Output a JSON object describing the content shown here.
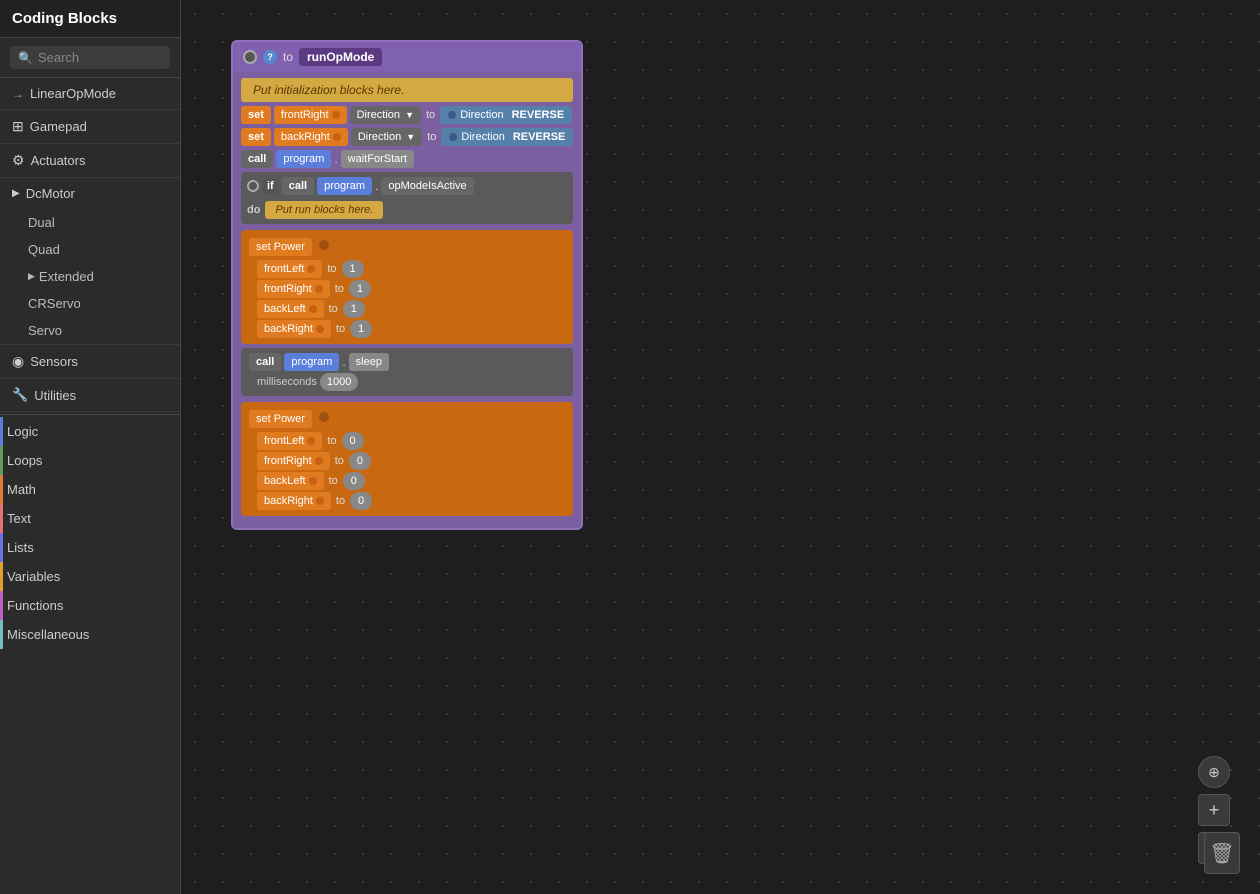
{
  "sidebar": {
    "title": "Coding Blocks",
    "search_placeholder": "Search",
    "items": [
      {
        "id": "linear-op-mode",
        "label": "LinearOpMode",
        "icon": "→",
        "type": "arrow"
      },
      {
        "id": "gamepad",
        "label": "Gamepad",
        "icon": "⊞",
        "type": "icon"
      },
      {
        "id": "actuators",
        "label": "Actuators",
        "icon": "⚙",
        "type": "icon"
      },
      {
        "id": "dc-motor",
        "label": "DcMotor",
        "icon": "▶",
        "type": "expand"
      },
      {
        "id": "dual",
        "label": "Dual",
        "type": "sub"
      },
      {
        "id": "quad",
        "label": "Quad",
        "type": "sub"
      },
      {
        "id": "extended",
        "label": "Extended",
        "type": "sub-expand"
      },
      {
        "id": "crservo",
        "label": "CRServo",
        "type": "sub"
      },
      {
        "id": "servo",
        "label": "Servo",
        "type": "sub"
      },
      {
        "id": "sensors",
        "label": "Sensors",
        "icon": "👁",
        "type": "icon"
      },
      {
        "id": "utilities",
        "label": "Utilities",
        "icon": "🔧",
        "type": "icon"
      }
    ],
    "categories": [
      {
        "id": "logic",
        "label": "Logic",
        "color": "#5b7edb"
      },
      {
        "id": "loops",
        "label": "Loops",
        "color": "#5b9e5b"
      },
      {
        "id": "math",
        "label": "Math",
        "color": "#e07b3a"
      },
      {
        "id": "text",
        "label": "Text",
        "color": "#e87070"
      },
      {
        "id": "lists",
        "label": "Lists",
        "color": "#7070e8"
      },
      {
        "id": "variables",
        "label": "Variables",
        "color": "#e0a030"
      },
      {
        "id": "functions",
        "label": "Functions",
        "color": "#c060c0"
      },
      {
        "id": "miscellaneous",
        "label": "Miscellaneous",
        "color": "#70c0c0"
      }
    ]
  },
  "canvas": {
    "blocks": {
      "op_mode_header": {
        "to_label": "to",
        "run_label": "runOpMode"
      },
      "init_placeholder": "Put initialization blocks here.",
      "set1_label": "set",
      "front_right_label": "frontRight",
      "direction_label1": "Direction",
      "to_label": "to",
      "direction_block1": "Direction",
      "reverse_label1": "REVERSE",
      "set2_label": "set",
      "back_right_label": "backRight",
      "direction_label2": "Direction",
      "direction_block2": "Direction",
      "reverse_label2": "REVERSE",
      "call_label1": "call",
      "program_label1": "program",
      "wait_for_start": "waitForStart",
      "if_label": "if",
      "call_label2": "call",
      "program_label2": "program",
      "op_mode_active": "opModeIsActive",
      "do_label": "do",
      "run_placeholder": "Put run blocks here.",
      "set_power1": "set Power",
      "front_left1": "frontLeft",
      "to1": "to",
      "val_1a": "1",
      "front_right_val": "frontRight",
      "to2": "to",
      "val_1b": "1",
      "back_left1": "backLeft",
      "to3": "to",
      "val_1c": "1",
      "back_right_val": "backRight",
      "to4": "to",
      "val_1d": "1",
      "call_sleep": "call",
      "program_sleep": "program",
      "sleep_method": "sleep",
      "milliseconds_label": "milliseconds",
      "ms_value": "1000",
      "set_power2": "set Power",
      "front_left2": "frontLeft",
      "to5": "to",
      "val_0a": "0",
      "front_right2": "frontRight",
      "to6": "to",
      "val_0b": "0",
      "back_left2": "backLeft",
      "to7": "to",
      "val_0c": "0",
      "back_right2": "backRight",
      "to8": "to",
      "val_0d": "0"
    }
  },
  "icons": {
    "search": "🔍",
    "gear": "⚙",
    "gamepad": "⊞",
    "arrow": "→",
    "triangle": "▶",
    "sensor": "◉",
    "wrench": "🔧",
    "trash": "🗑",
    "center": "⊕",
    "zoom_in": "+",
    "zoom_out": "−"
  }
}
